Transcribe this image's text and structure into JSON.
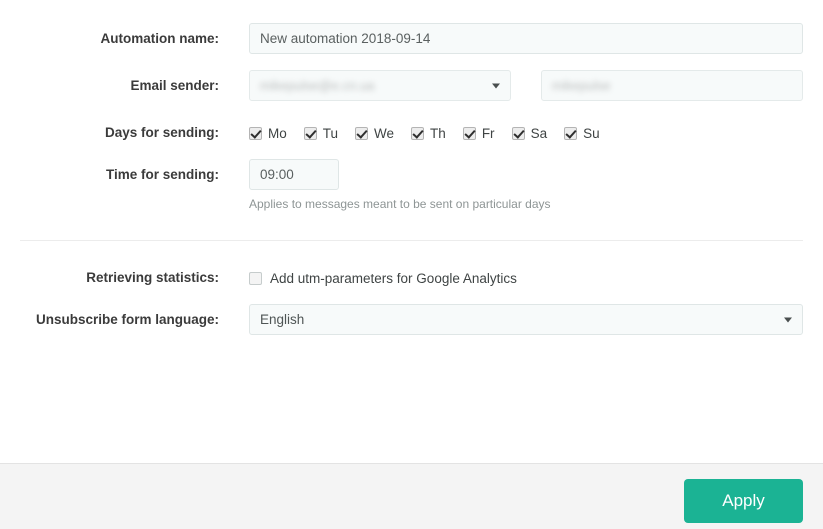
{
  "form": {
    "rows": [
      {
        "label": "Automation name:",
        "value": "New automation 2018-09-14",
        "placeholder": "New automation 2018-09-14"
      },
      {
        "label": "Email sender:",
        "sender_email_redacted": "mikepulse@e.cn.ua",
        "sender_name_redacted": "mikepulse"
      },
      {
        "label": "Days for sending:"
      },
      {
        "label": "Time for sending:",
        "value": "09:00",
        "placeholder": "09:00",
        "help": "Applies to messages meant to be sent on particular days"
      },
      {
        "label": "Retrieving statistics:",
        "checkbox_label": "Add utm-parameters for Google Analytics",
        "checked": false
      },
      {
        "label": "Unsubscribe form language:",
        "value": "English"
      }
    ],
    "days": [
      {
        "code": "Mo",
        "checked": true
      },
      {
        "code": "Tu",
        "checked": true
      },
      {
        "code": "We",
        "checked": true
      },
      {
        "code": "Th",
        "checked": true
      },
      {
        "code": "Fr",
        "checked": true
      },
      {
        "code": "Sa",
        "checked": true
      },
      {
        "code": "Su",
        "checked": true
      }
    ]
  },
  "footer": {
    "apply_label": "Apply"
  },
  "colors": {
    "accent_green": "#1bb394",
    "footer_bg": "#f4f4f4",
    "input_bg": "#f7fafa",
    "input_border": "#dfe6e6",
    "label_text": "#3b3b3b",
    "help_text": "#8e9595"
  }
}
